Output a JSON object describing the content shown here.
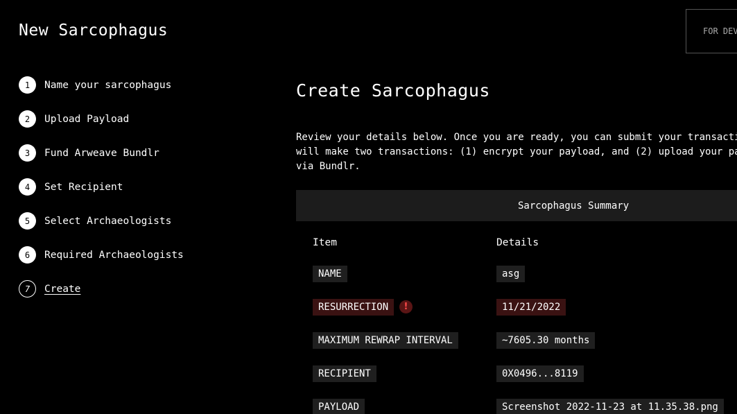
{
  "app": {
    "title": "New Sarcophagus",
    "dev_button": "FOR DEVELOPERS"
  },
  "steps": [
    {
      "number": "1",
      "label": "Name your sarcophagus"
    },
    {
      "number": "2",
      "label": "Upload Payload"
    },
    {
      "number": "3",
      "label": "Fund Arweave Bundlr"
    },
    {
      "number": "4",
      "label": "Set Recipient"
    },
    {
      "number": "5",
      "label": "Select Archaeologists"
    },
    {
      "number": "6",
      "label": "Required Archaeologists"
    },
    {
      "number": "7",
      "label": "Create",
      "active": true
    }
  ],
  "main": {
    "title": "Create Sarcophagus",
    "description": "Review your details below. Once you are ready, you can submit your transacti will make two transactions: (1) encrypt your payload, and (2) upload your pa via Bundlr."
  },
  "summary": {
    "title": "Sarcophagus Summary",
    "col_item": "Item",
    "col_details": "Details",
    "rows": [
      {
        "item": "NAME",
        "value": "asg",
        "warning": false
      },
      {
        "item": "RESURRECTION",
        "value": "11/21/2022",
        "warning": true
      },
      {
        "item": "MAXIMUM REWRAP INTERVAL",
        "value": "~7605.30 months",
        "warning": false
      },
      {
        "item": "RECIPIENT",
        "value": "0X0496...8119",
        "warning": false
      },
      {
        "item": "PAYLOAD",
        "value": "Screenshot 2022-11-23 at 11.35.38.png",
        "warning": false
      }
    ]
  },
  "icons": {
    "warning": "exclamation-icon"
  },
  "colors": {
    "background": "#000000",
    "tag_bg": "#1f1f1f",
    "warning_bg": "#3a1212",
    "warning_fg": "#ff4a4a"
  }
}
